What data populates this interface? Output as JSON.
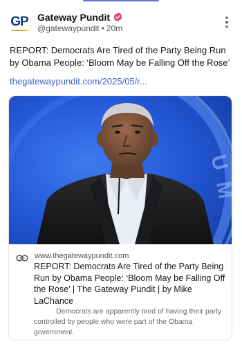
{
  "post": {
    "author_name": "Gateway Pundit",
    "handle": "@gatewaypundit",
    "separator": "•",
    "time": "20m",
    "avatar_text": "GP",
    "text": "REPORT: Democrats Are Tired of the Party Being Run by Obama People: ‘Bloom May be Falling Off the Rose’",
    "link_text": "thegatewaypundit.com/2025/05/r..."
  },
  "card": {
    "domain": "www.thegatewaypundit.com",
    "title": "REPORT: Democrats Are Tired of the Party Being Run by Obama People: ‘Bloom May be Falling Off the Rose’ | The Gateway Pundit | by Mike LaChance",
    "description": "Democrats are apparently tired of having their party controlled by people who were part of the Obama government."
  },
  "icons": {
    "verified": "verified-badge-icon",
    "menu": "more-vertical-icon",
    "link": "link-icon"
  },
  "colors": {
    "accent": "#5b6cf0",
    "link": "#3b63c4",
    "verified": "#e0457b",
    "image_background": "#1f5bd8"
  }
}
